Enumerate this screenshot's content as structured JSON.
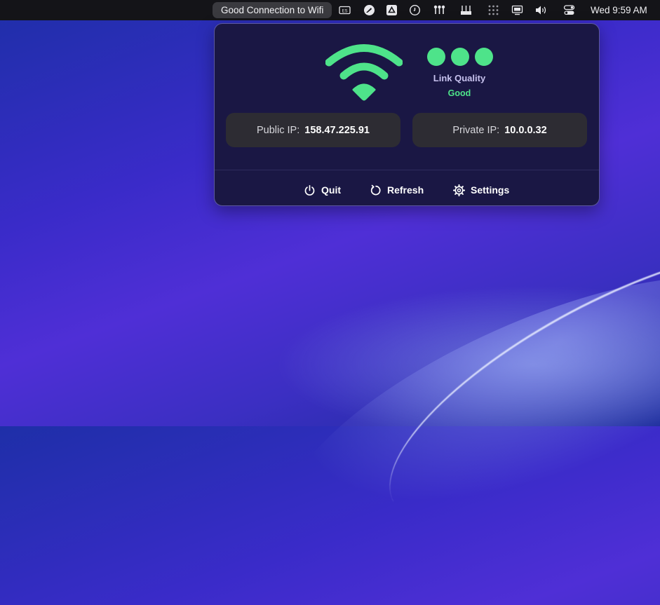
{
  "menubar": {
    "status_text": "Good Connection to Wifi",
    "clock": "Wed 9:59 AM",
    "icons": [
      "keyboard-icon",
      "compass-icon",
      "drive-icon",
      "clock-app-icon",
      "network-icon",
      "tools-icon",
      "grid-icon",
      "display-icon",
      "volume-icon",
      "control-center-icon"
    ]
  },
  "popover": {
    "link_quality_label": "Link Quality",
    "link_quality_value": "Good",
    "public_ip_label": "Public IP:",
    "public_ip_value": "158.47.225.91",
    "private_ip_label": "Private IP:",
    "private_ip_value": "10.0.0.32",
    "quit_label": "Quit",
    "refresh_label": "Refresh",
    "settings_label": "Settings",
    "accent_color": "#4ee38a"
  }
}
